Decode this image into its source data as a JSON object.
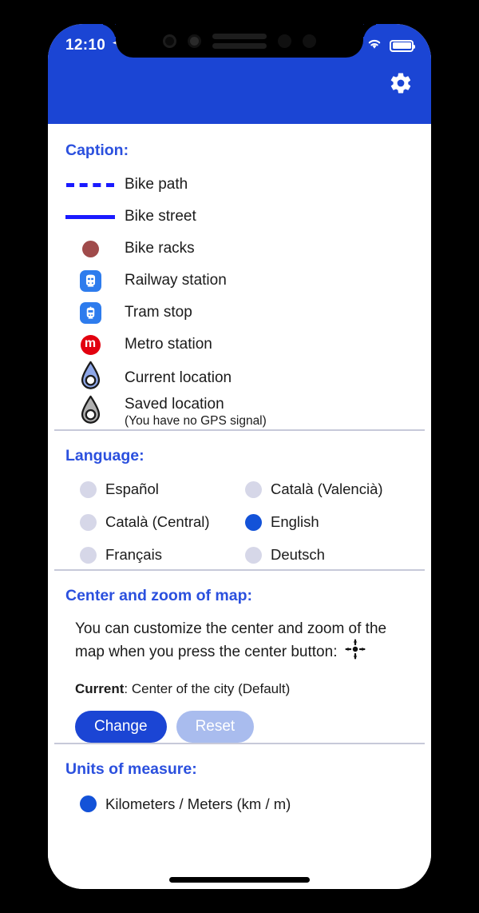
{
  "status_bar": {
    "time": "12:10",
    "location_arrow_icon": "location-arrow-icon",
    "signal_icon": "signal-dots-icon",
    "wifi_icon": "wifi-icon",
    "battery_icon": "battery-full-icon"
  },
  "header": {
    "background_color": "#1b45d4",
    "settings_icon": "gear-icon"
  },
  "caption": {
    "heading": "Caption:",
    "items": [
      {
        "label": "Bike path",
        "icon": "dashed-line-icon",
        "color": "#1a1aff"
      },
      {
        "label": "Bike street",
        "icon": "solid-line-icon",
        "color": "#1a1aff"
      },
      {
        "label": "Bike racks",
        "icon": "filled-dot-icon",
        "color": "#a04b4b"
      },
      {
        "label": "Railway station",
        "icon": "train-icon",
        "color": "#2e7ced"
      },
      {
        "label": "Tram stop",
        "icon": "tram-icon",
        "color": "#2e7ced"
      },
      {
        "label": "Metro station",
        "icon": "metro-m-icon",
        "color": "#e2000f",
        "glyph": "m"
      },
      {
        "label": "Current location",
        "icon": "map-pin-current-icon",
        "color": "#8ea7e8"
      },
      {
        "label": "Saved location",
        "sub": "(You have no GPS signal)",
        "icon": "map-pin-saved-icon",
        "color": "#b0b0b0"
      }
    ]
  },
  "language": {
    "heading": "Language:",
    "options": [
      {
        "label": "Español",
        "selected": false
      },
      {
        "label": "Català (Valencià)",
        "selected": false
      },
      {
        "label": "Català (Central)",
        "selected": false
      },
      {
        "label": "English",
        "selected": true
      },
      {
        "label": "Français",
        "selected": false
      },
      {
        "label": "Deutsch",
        "selected": false
      }
    ]
  },
  "center_zoom": {
    "heading": "Center and zoom of map:",
    "description": "You can customize the center and zoom of the map when you press the center button:",
    "center_button_icon": "center-crosshair-icon",
    "current_label": "Current",
    "current_separator": ": ",
    "current_value": "Center of the city (Default)",
    "change_button": "Change",
    "reset_button": "Reset"
  },
  "units": {
    "heading": "Units of measure:",
    "options": [
      {
        "label": "Kilometers / Meters (km / m)",
        "selected": true
      }
    ]
  },
  "colors": {
    "accent_blue": "#1b45d4",
    "heading_blue": "#2b50de",
    "radio_off": "#d6d7e8",
    "radio_on": "#1352d8",
    "divider": "#c7c9d9",
    "muted_button": "#a9bcee"
  }
}
